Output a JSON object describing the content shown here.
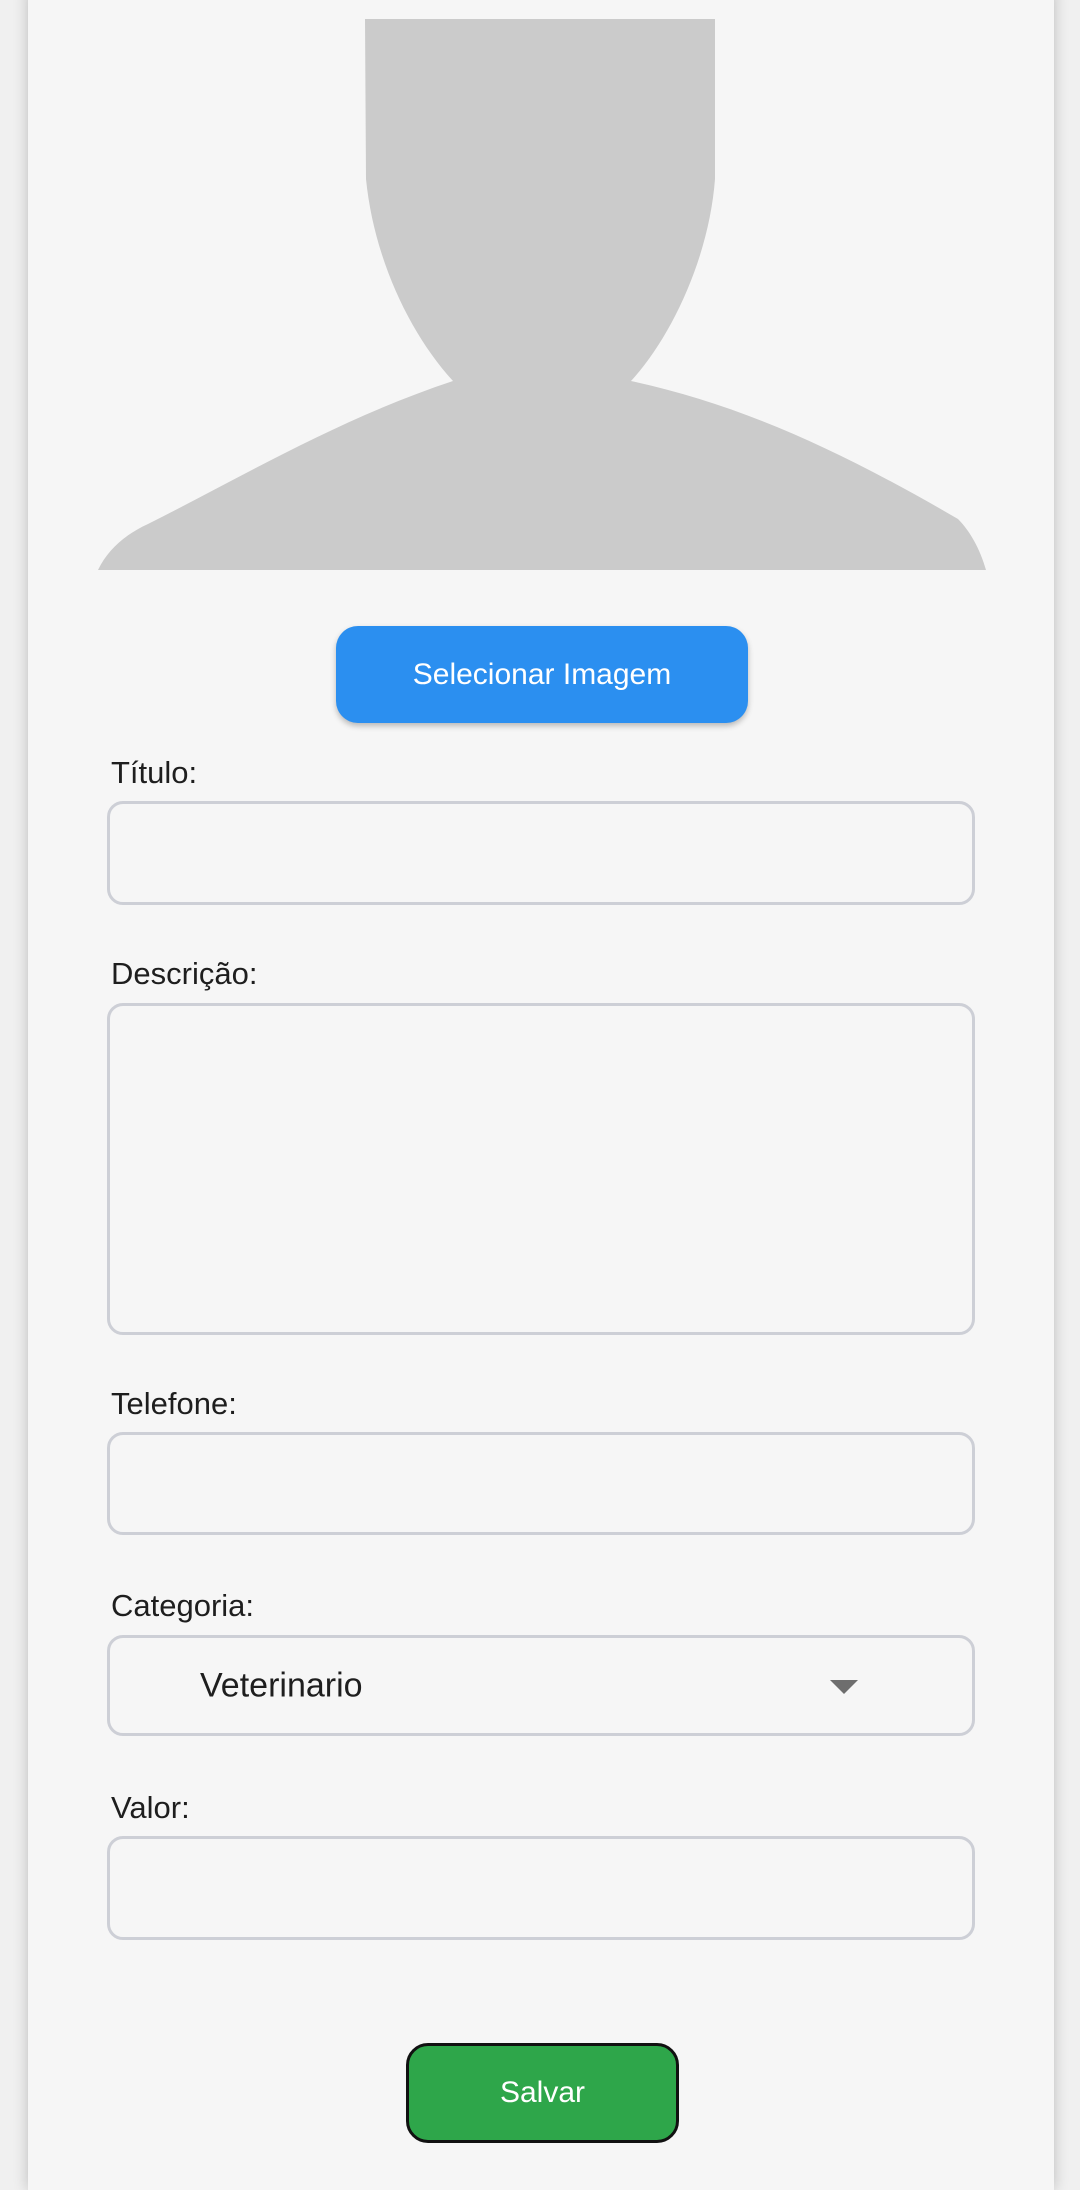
{
  "image_picker": {
    "placeholder_icon": "person-silhouette-icon",
    "button_label": "Selecionar Imagem"
  },
  "form": {
    "title_label": "Título:",
    "title_value": "",
    "description_label": "Descrição:",
    "description_value": "",
    "phone_label": "Telefone:",
    "phone_value": "",
    "category_label": "Categoria:",
    "category_value": "Veterinario",
    "price_label": "Valor:",
    "price_value": ""
  },
  "actions": {
    "save_label": "Salvar"
  },
  "colors": {
    "primary": "#2b8ff0",
    "success": "#2ea64a",
    "border": "#cdcfd6",
    "placeholder": "#cbcbcb"
  }
}
